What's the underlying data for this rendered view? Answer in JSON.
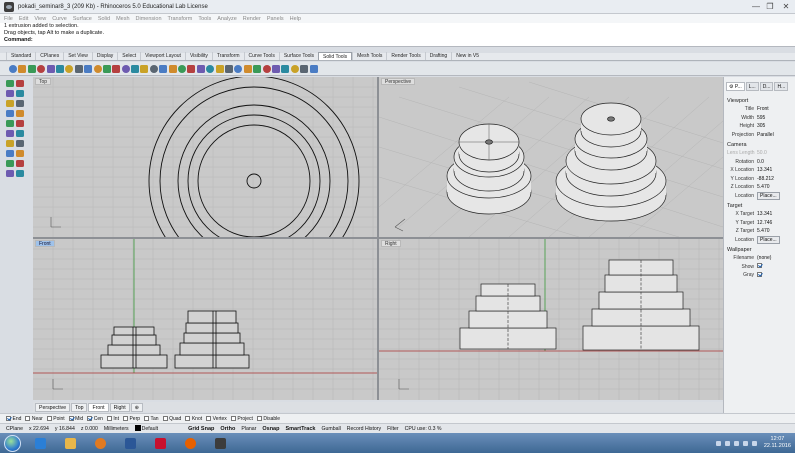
{
  "window": {
    "title": "pokadi_seminar8_3 (209 Kb) - Rhinoceros 5.0 Educational Lab License",
    "controls": [
      "—",
      "❐",
      "✕"
    ]
  },
  "menu": [
    "File",
    "Edit",
    "View",
    "Curve",
    "Surface",
    "Solid",
    "Mesh",
    "Dimension",
    "Transform",
    "Tools",
    "Analyze",
    "Render",
    "Panels",
    "Help"
  ],
  "command_history": [
    "1 extrusion added to selection.",
    "Drag objects, tap Alt to make a duplicate."
  ],
  "command_prompt": "Command:",
  "toolbar_tabs": {
    "items": [
      "Standard",
      "CPlanes",
      "Set View",
      "Display",
      "Select",
      "Viewport Layout",
      "Visibility",
      "Transform",
      "Curve Tools",
      "Surface Tools",
      "Solid Tools",
      "Mesh Tools",
      "Render Tools",
      "Drafting",
      "New in V5"
    ],
    "active": "Solid Tools"
  },
  "toolbar_icons": [
    "sphere-icon",
    "box-icon",
    "cylinder-icon",
    "cone-icon",
    "torus-icon",
    "pipe-icon",
    "boolean-union-icon",
    "boolean-difference-icon",
    "boolean-intersection-icon",
    "boolean-split-icon",
    "fillet-edge-icon",
    "chamfer-edge-icon",
    "shell-icon",
    "cap-holes-icon",
    "extract-surface-icon",
    "move-face-icon",
    "extrude-face-icon",
    "split-face-icon",
    "merge-face-icon",
    "wire-cut-icon",
    "move-edge-icon",
    "make-hole-icon",
    "place-hole-icon",
    "rotate-hole-icon",
    "array-hole-icon",
    "solid-edit-icon",
    "history-icon",
    "points-on-icon",
    "rebuild-edge-icon",
    "extrude-curve-icon",
    "slab-icon",
    "solid-options-icon",
    "render-icon"
  ],
  "viewports": {
    "top": "Top",
    "perspective": "Perspective",
    "front": "Front",
    "right": "Right"
  },
  "view_tabs": {
    "items": [
      "Perspective",
      "Top",
      "Front",
      "Right",
      "⊕"
    ],
    "active": "Front"
  },
  "osnaps": [
    {
      "label": "End",
      "checked": true
    },
    {
      "label": "Near",
      "checked": false
    },
    {
      "label": "Point",
      "checked": false
    },
    {
      "label": "Mid",
      "checked": true
    },
    {
      "label": "Cen",
      "checked": true
    },
    {
      "label": "Int",
      "checked": false
    },
    {
      "label": "Perp",
      "checked": false
    },
    {
      "label": "Tan",
      "checked": false
    },
    {
      "label": "Quad",
      "checked": false
    },
    {
      "label": "Knot",
      "checked": false
    },
    {
      "label": "Vertex",
      "checked": false
    },
    {
      "label": "Project",
      "checked": false
    },
    {
      "label": "Disable",
      "checked": false
    }
  ],
  "status": {
    "cplane": "CPlane",
    "x": "x 22.694",
    "y": "y 16.844",
    "z": "z 0.000",
    "units": "Millimeters",
    "layer": "Default",
    "toggles": [
      "Grid Snap",
      "Ortho",
      "Planar",
      "Osnap",
      "SmartTrack",
      "Gumball",
      "Record History",
      "Filter"
    ],
    "bold_toggles": [
      "Grid Snap",
      "Ortho",
      "Osnap",
      "SmartTrack"
    ],
    "cpu": "CPU use: 0.3 %"
  },
  "panel": {
    "tabs": [
      "⚙ P...",
      "L...",
      "D...",
      "H..."
    ],
    "active_tab": "⚙ P...",
    "viewport_section": "Viewport",
    "title_label": "Title",
    "title_value": "Front",
    "width_label": "Width",
    "width_value": "595",
    "height_label": "Height",
    "height_value": "305",
    "projection_label": "Projection",
    "projection_value": "Parallel",
    "camera_section": "Camera",
    "lens_label": "Lens Length",
    "lens_value": "50.0",
    "rotation_label": "Rotation",
    "rotation_value": "0.0",
    "xloc_label": "X Location",
    "xloc_value": "13.341",
    "yloc_label": "Y Location",
    "yloc_value": "-88.212",
    "zloc_label": "Z Location",
    "zloc_value": "5.470",
    "location_label": "Location",
    "place_button": "Place...",
    "target_section": "Target",
    "xtgt_label": "X Target",
    "xtgt_value": "13.341",
    "ytgt_label": "Y Target",
    "ytgt_value": "12.746",
    "ztgt_label": "Z Target",
    "ztgt_value": "5.470",
    "tloc_label": "Location",
    "tplace_button": "Place...",
    "wallpaper_section": "Wallpaper",
    "filename_label": "Filename",
    "filename_value": "(none)",
    "show_label": "Show",
    "gray_label": "Gray"
  },
  "taskbar": {
    "apps": [
      "explorer-icon",
      "folder-icon",
      "media-player-icon",
      "word-icon",
      "acrobat-icon",
      "firefox-icon",
      "rhino-icon"
    ],
    "time": "12:07",
    "date": "22.11.2016"
  },
  "colors": {
    "viewport_bg": "#c9c9c9",
    "grid_line": "#b3b3b3",
    "axis_red": "#a83232",
    "axis_green": "#3b9a3b",
    "active_label": "#9fc2ea",
    "taskbar": "#3e6894"
  }
}
